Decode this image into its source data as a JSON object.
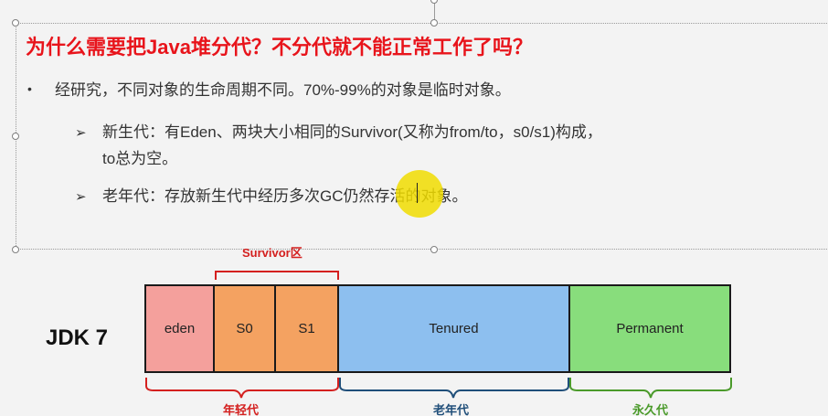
{
  "slide": {
    "title": "为什么需要把Java堆分代？不分代就不能正常工作了吗？",
    "bullet": {
      "glyph": "•",
      "text": "经研究，不同对象的生命周期不同。70%-99%的对象是临时对象。"
    },
    "subitems": [
      {
        "glyph": "➢",
        "text": "新生代：有Eden、两块大小相同的Survivor(又称为from/to，s0/s1)构成，",
        "continuation": "to总为空。"
      },
      {
        "glyph": "➢",
        "text": "老年代：存放新生代中经历多次GC仍然存活的对象。"
      }
    ]
  },
  "diagram": {
    "jdk_label": "JDK 7",
    "survivor_label": "Survivor区",
    "segments": [
      {
        "label": "eden",
        "color": "#f4a09c"
      },
      {
        "label": "S0",
        "color": "#f4a261"
      },
      {
        "label": "S1",
        "color": "#f4a261"
      },
      {
        "label": "Tenured",
        "color": "#8dbfef"
      },
      {
        "label": "Permanent",
        "color": "#88dd7c"
      }
    ],
    "young_label": "年轻代",
    "old_label": "老年代",
    "perm_label": "永久代",
    "colors": {
      "survivor_brace": "#d4201f",
      "young_brace": "#d4201f",
      "old_brace": "#1f4e79",
      "perm_brace": "#4a9a2a",
      "title": "#e8141b",
      "highlight": "#f0dc00"
    }
  }
}
